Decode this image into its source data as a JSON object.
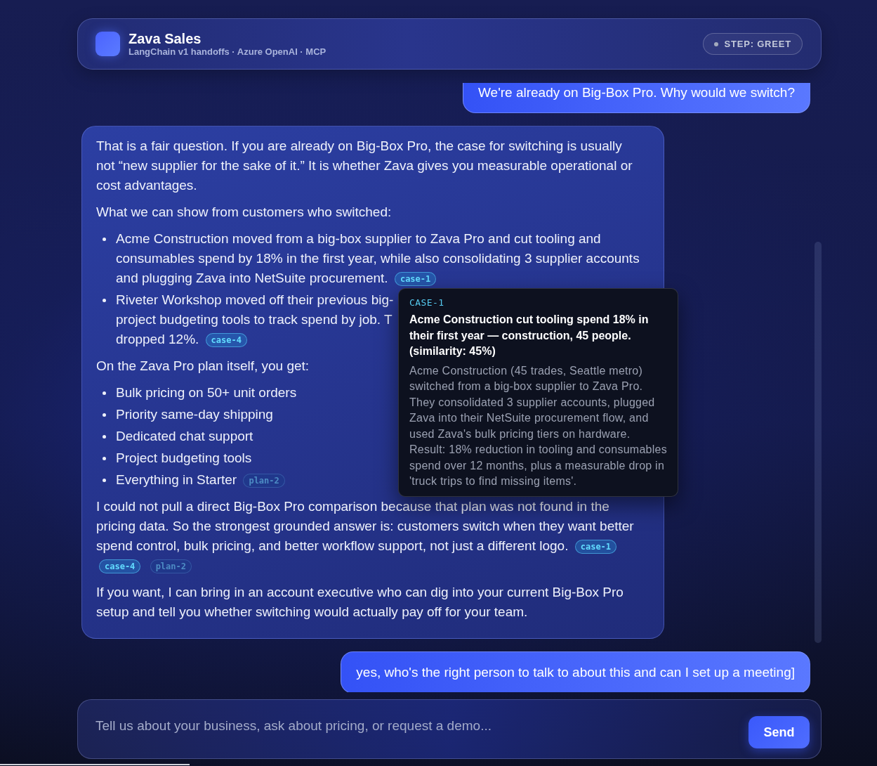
{
  "header": {
    "title": "Zava Sales",
    "subtitle": "LangChain v1 handoffs · Azure OpenAI · MCP",
    "step": "STEP: GREET"
  },
  "messages": [
    {
      "kind": "user",
      "text": "We're already on Big-Box Pro. Why would we switch?"
    },
    {
      "kind": "assistant",
      "blocks": [
        {
          "kind": "paragraph",
          "lines": [
            "That is a fair question. If you are already on Big-Box Pro, the case for switching is usually not “new supplier for the sake of it.” It is whether Zava gives you measurable operational or cost advantages."
          ]
        },
        {
          "kind": "paragraph",
          "lines": [
            "What we can show from customers who switched:"
          ]
        },
        {
          "kind": "list",
          "items": [
            {
              "lines": [
                "Acme Construction moved from a big-box supplier to Zava Pro and cut tooling and",
                "consumables spend by 18% in the first year, while also consolidating 3 supplier accounts",
                "and plugging Zava into NetSuite procurement."
              ],
              "citations": [
                {
                  "label": "case-1",
                  "kind": "case"
                }
              ]
            },
            {
              "lines": [
                "Riveter Workshop moved off their previous big-",
                "project budgeting tools to track spend by job. T",
                "dropped 12%."
              ],
              "citations": [
                {
                  "label": "case-4",
                  "kind": "case"
                }
              ]
            }
          ]
        },
        {
          "kind": "paragraph",
          "lines": [
            "On the Zava Pro plan itself, you get:"
          ]
        },
        {
          "kind": "list",
          "items": [
            {
              "lines": [
                "Bulk pricing on 50+ unit orders"
              ]
            },
            {
              "lines": [
                "Priority same-day shipping"
              ]
            },
            {
              "lines": [
                "Dedicated chat support"
              ]
            },
            {
              "lines": [
                "Project budgeting tools"
              ]
            },
            {
              "lines": [
                "Everything in Starter"
              ],
              "citations": [
                {
                  "label": "plan-2",
                  "kind": "plan"
                }
              ]
            }
          ]
        },
        {
          "kind": "paragraph",
          "lines": [
            "I could not pull a direct Big-Box Pro comparison because that plan was not found in the",
            "pricing data. So the strongest grounded answer is: customers switch when they want better",
            "spend control, bulk pricing, and better workflow support, not just a different logo."
          ],
          "citations": [
            {
              "label": "case-1",
              "kind": "case"
            },
            {
              "label": "case-4",
              "kind": "case"
            },
            {
              "label": "plan-2",
              "kind": "plan"
            }
          ]
        },
        {
          "kind": "paragraph",
          "lines": [
            "If you want, I can bring in an account executive who can dig into your current Big-Box Pro setup and tell you whether switching would actually pay off for your team."
          ]
        }
      ],
      "tooltip": {
        "label": "CASE-1",
        "title": "Acme Construction cut tooling spend 18% in their first year — construction, 45 people. (similarity: 45%)",
        "body": "Acme Construction (45 trades, Seattle metro) switched from a big-box supplier to Zava Pro. They consolidated 3 supplier accounts, plugged Zava into their NetSuite procurement flow, and used Zava's bulk pricing tiers on hardware. Result: 18% reduction in tooling and consumables spend over 12 months, plus a measurable drop in 'truck trips to find missing items'."
      }
    },
    {
      "kind": "user",
      "text": "yes, who's the right person to talk to about this and can I set up a meeting]"
    }
  ],
  "composer": {
    "placeholder": "Tell us about your business, ask about pricing, or request a demo...",
    "send": "Send"
  }
}
